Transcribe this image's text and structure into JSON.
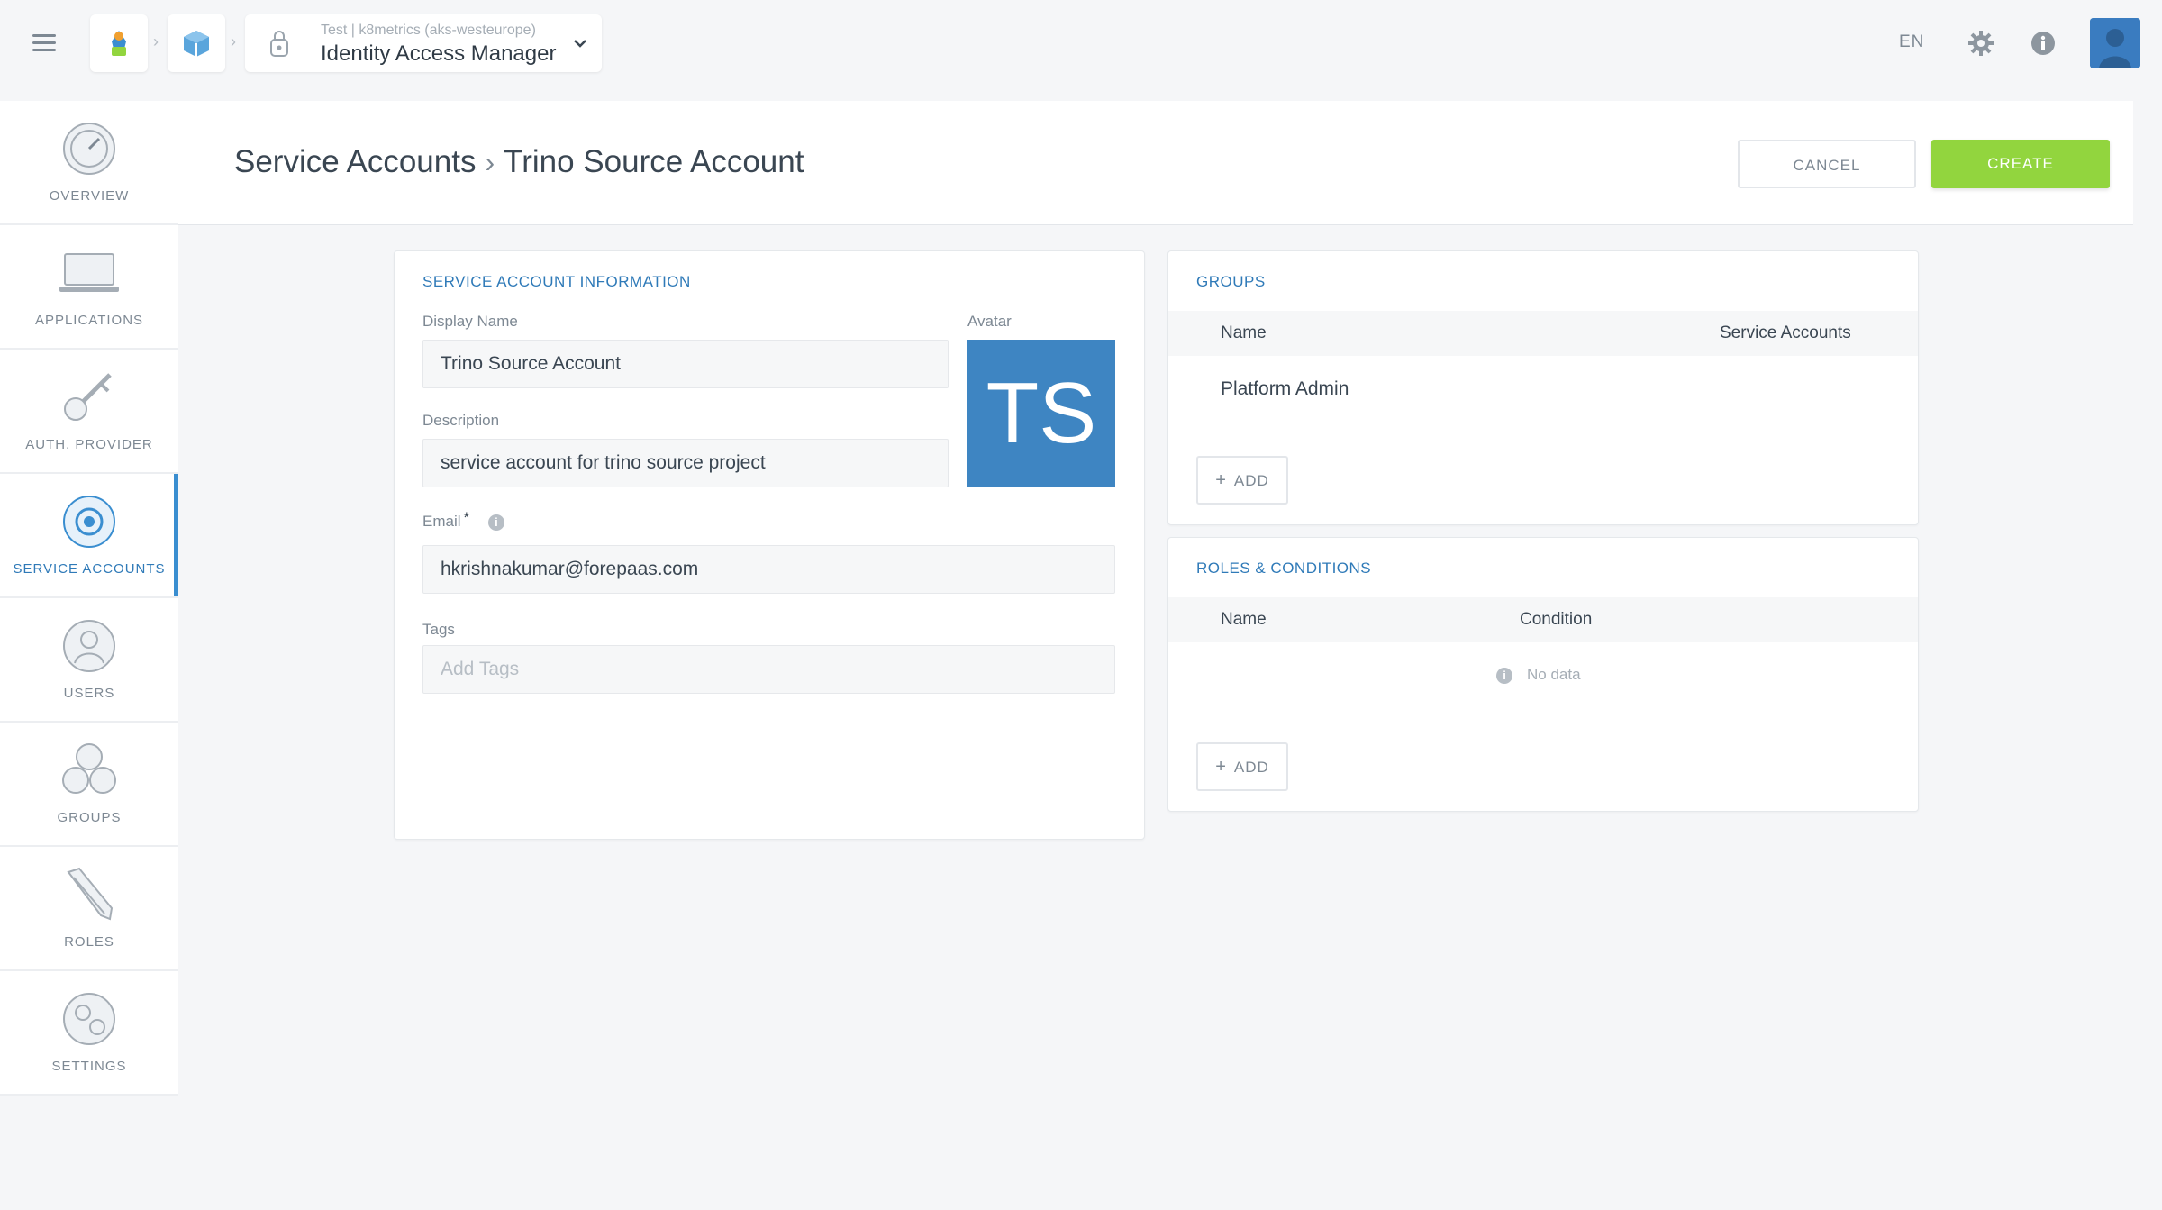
{
  "topbar": {
    "app_subtitle": "Test | k8metrics (aks-westeurope)",
    "app_title": "Identity Access Manager",
    "language": "EN"
  },
  "sidebar": {
    "items": [
      {
        "label": "OVERVIEW",
        "icon": "overview-icon",
        "active": false
      },
      {
        "label": "APPLICATIONS",
        "icon": "laptop-icon",
        "active": false
      },
      {
        "label": "AUTH. PROVIDER",
        "icon": "key-icon",
        "active": false
      },
      {
        "label": "SERVICE ACCOUNTS",
        "icon": "service-accounts-icon",
        "active": true
      },
      {
        "label": "USERS",
        "icon": "user-icon",
        "active": false
      },
      {
        "label": "GROUPS",
        "icon": "groups-icon",
        "active": false
      },
      {
        "label": "ROLES",
        "icon": "pencil-icon",
        "active": false
      },
      {
        "label": "SETTINGS",
        "icon": "settings-icon",
        "active": false
      }
    ]
  },
  "header": {
    "breadcrumb_parent": "Service Accounts",
    "breadcrumb_current": "Trino Source Account",
    "cancel_label": "CANCEL",
    "create_label": "CREATE"
  },
  "info_card": {
    "title": "SERVICE ACCOUNT INFORMATION",
    "display_name_label": "Display Name",
    "display_name_value": "Trino Source Account",
    "avatar_label": "Avatar",
    "avatar_initials": "TS",
    "description_label": "Description",
    "description_value": "service account for trino source project",
    "email_label": "Email",
    "email_required": "*",
    "email_value": "hkrishnakumar@forepaas.com",
    "tags_label": "Tags",
    "tags_placeholder": "Add Tags"
  },
  "groups_card": {
    "title": "GROUPS",
    "col_name": "Name",
    "col_service_accounts": "Service Accounts",
    "rows": [
      {
        "name": "Platform Admin"
      }
    ],
    "add_label": "ADD"
  },
  "roles_card": {
    "title": "ROLES & CONDITIONS",
    "col_name": "Name",
    "col_condition": "Condition",
    "empty_text": "No data",
    "add_label": "ADD"
  },
  "colors": {
    "accent_blue": "#2f7ab8",
    "create_green": "#92d53e",
    "avatar_blue": "#3e85c2"
  }
}
